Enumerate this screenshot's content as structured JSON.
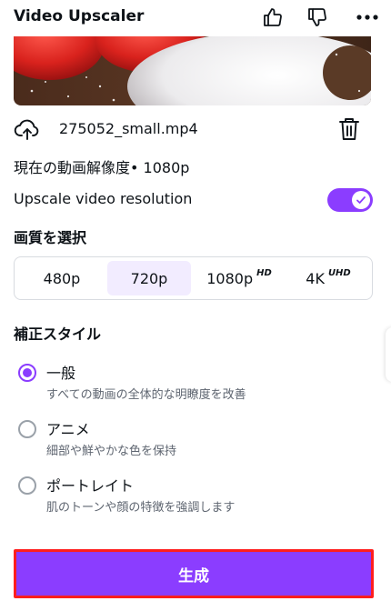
{
  "header": {
    "title": "Video Upscaler",
    "icons": [
      "thumbs-up-icon",
      "thumbs-down-icon",
      "more-icon"
    ]
  },
  "file": {
    "name": "275052_small.mp4",
    "icons": [
      "upload-cloud-icon",
      "trash-icon"
    ]
  },
  "current_resolution": "現在の動画解像度• 1080p",
  "upscale_toggle": {
    "label": "Upscale video resolution",
    "on": true
  },
  "quality": {
    "title": "画質を選択",
    "options": [
      {
        "label": "480p",
        "tag": ""
      },
      {
        "label": "720p",
        "tag": ""
      },
      {
        "label": "1080p",
        "tag": "HD"
      },
      {
        "label": "4K",
        "tag": "UHD"
      }
    ],
    "selected": "720p"
  },
  "style": {
    "title": "補正スタイル",
    "options": [
      {
        "label": "一般",
        "desc": "すべての動画の全体的な明瞭度を改善",
        "selected": true
      },
      {
        "label": "アニメ",
        "desc": "細部や鮮やかな色を保持",
        "selected": false
      },
      {
        "label": "ポートレイト",
        "desc": "肌のトーンや顔の特徴を強調します",
        "selected": false
      }
    ]
  },
  "generate_button": "生成",
  "colors": {
    "accent": "#8b3dff",
    "selected_bg": "#f2ecff",
    "highlight_border": "#ff1e1e"
  }
}
